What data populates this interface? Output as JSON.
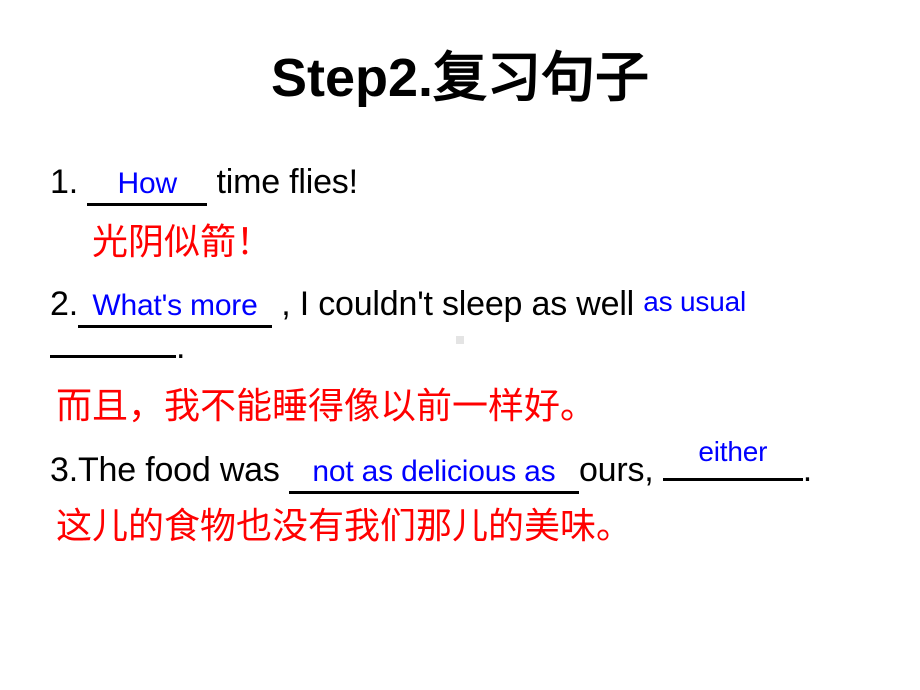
{
  "slide": {
    "title_en": "Step2.",
    "title_cn": "复习句子",
    "colors": {
      "answer_blue": "#0000FF",
      "translation_red": "#FF0000",
      "text_black": "#000000",
      "background": "#FFFFFF"
    },
    "exercises": [
      {
        "number": "1.",
        "answer": "How",
        "tail": "time flies!",
        "translation": "光阴似箭！"
      },
      {
        "number": "2.",
        "answer": "What's more",
        "mid": ", I couldn't sleep as well",
        "answer2": "as usual",
        "tail": ".",
        "translation": "而且，我不能睡得像以前一样好。"
      },
      {
        "number": "3.",
        "lead": "The food was",
        "answer": "not as delicious as",
        "mid": "ours,",
        "answer2": "either",
        "tail": ".",
        "translation": "这儿的食物也没有我们那儿的美味。"
      }
    ]
  }
}
